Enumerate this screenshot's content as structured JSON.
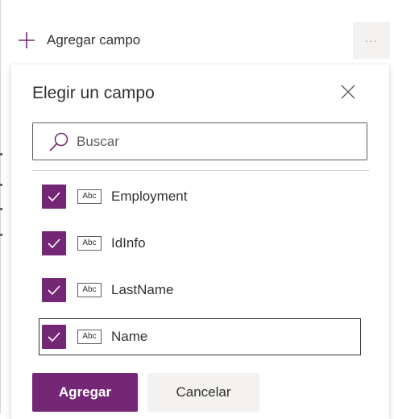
{
  "toolbar": {
    "add_field_label": "Agregar campo",
    "more_label": "···"
  },
  "panel": {
    "title": "Elegir un campo",
    "search": {
      "placeholder": "Buscar",
      "value": ""
    },
    "fields": [
      {
        "name": "Employment",
        "type_label": "Abc",
        "checked": true
      },
      {
        "name": "IdInfo",
        "type_label": "Abc",
        "checked": true
      },
      {
        "name": "LastName",
        "type_label": "Abc",
        "checked": true
      },
      {
        "name": "Name",
        "type_label": "Abc",
        "checked": true
      }
    ],
    "buttons": {
      "primary": "Agregar",
      "secondary": "Cancelar"
    }
  },
  "colors": {
    "accent": "#742774",
    "text": "#323130",
    "button_neutral": "#f3f2f1"
  },
  "icons": {
    "add": "plus-icon",
    "more": "more-icon",
    "close": "close-icon",
    "search": "search-icon",
    "check": "check-icon",
    "field_type": "text-field-icon"
  }
}
